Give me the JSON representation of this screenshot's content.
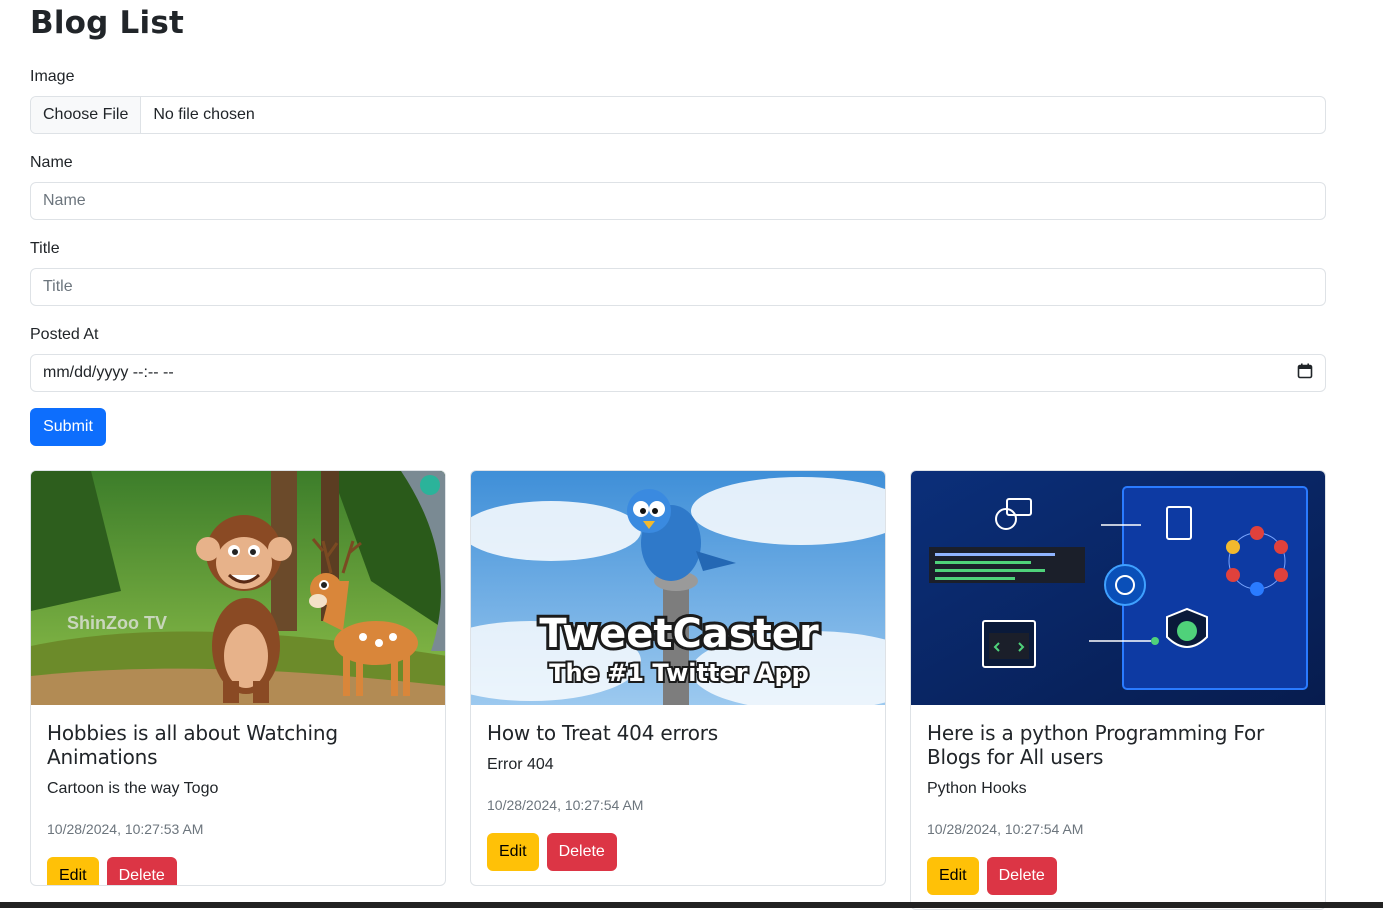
{
  "page": {
    "title": "Blog List"
  },
  "form": {
    "image_label": "Image",
    "file_button": "Choose File",
    "file_status": "No file chosen",
    "name_label": "Name",
    "name_placeholder": "Name",
    "title_label": "Title",
    "title_placeholder": "Title",
    "posted_label": "Posted At",
    "posted_value": "mm/dd/yyyy --:-- --",
    "submit_label": "Submit"
  },
  "posts": [
    {
      "title": "Hobbies is all about Watching Animations",
      "subtitle": "Cartoon is the way Togo",
      "date": "10/28/2024, 10:27:53 AM",
      "image_caption": "ShinZoo TV",
      "edit_label": "Edit",
      "delete_label": "Delete"
    },
    {
      "title": "How to Treat 404 errors",
      "subtitle": "Error 404",
      "date": "10/28/2024, 10:27:54 AM",
      "image_caption": "TweetCaster",
      "image_caption2": "The #1 Twitter App",
      "edit_label": "Edit",
      "delete_label": "Delete"
    },
    {
      "title": "Here is a python Programming For Blogs for All users",
      "subtitle": "Python Hooks",
      "date": "10/28/2024, 10:27:54 AM",
      "edit_label": "Edit",
      "delete_label": "Delete"
    }
  ],
  "colors": {
    "primary": "#0d6efd",
    "warning": "#ffc107",
    "danger": "#dc3545"
  }
}
